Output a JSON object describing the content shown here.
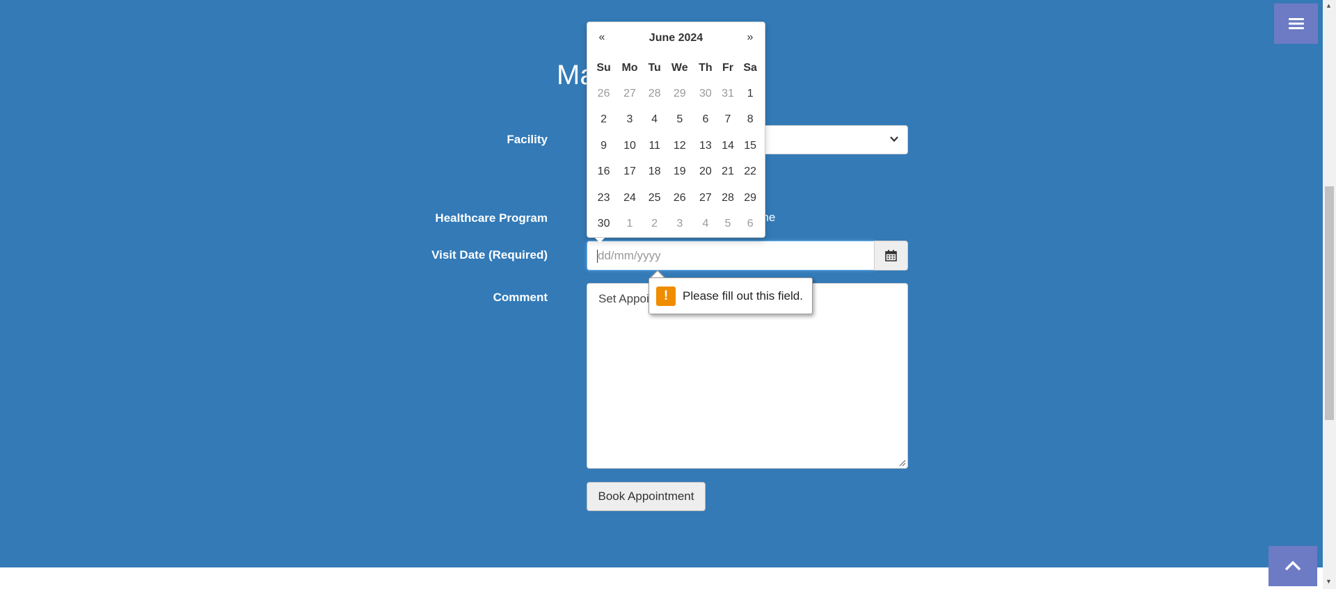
{
  "page": {
    "title_visible": "Ma"
  },
  "form": {
    "facility_label": "Facility",
    "program_label": "Healthcare Program",
    "program_value_visible": "one",
    "visit_date_label": "Visit Date (Required)",
    "visit_date_placeholder": "dd/mm/yyyy",
    "visit_date_value": "",
    "comment_label": "Comment",
    "comment_value_visible": "Set Appoi",
    "book_button": "Book Appointment"
  },
  "datepicker": {
    "prev": "«",
    "next": "»",
    "title": "June 2024",
    "weekdays": [
      "Su",
      "Mo",
      "Tu",
      "We",
      "Th",
      "Fr",
      "Sa"
    ],
    "weeks": [
      [
        {
          "d": "26",
          "m": true
        },
        {
          "d": "27",
          "m": true
        },
        {
          "d": "28",
          "m": true
        },
        {
          "d": "29",
          "m": true
        },
        {
          "d": "30",
          "m": true
        },
        {
          "d": "31",
          "m": true
        },
        {
          "d": "1",
          "m": false
        }
      ],
      [
        {
          "d": "2",
          "m": false
        },
        {
          "d": "3",
          "m": false
        },
        {
          "d": "4",
          "m": false
        },
        {
          "d": "5",
          "m": false
        },
        {
          "d": "6",
          "m": false
        },
        {
          "d": "7",
          "m": false
        },
        {
          "d": "8",
          "m": false
        }
      ],
      [
        {
          "d": "9",
          "m": false
        },
        {
          "d": "10",
          "m": false
        },
        {
          "d": "11",
          "m": false
        },
        {
          "d": "12",
          "m": false
        },
        {
          "d": "13",
          "m": false
        },
        {
          "d": "14",
          "m": false
        },
        {
          "d": "15",
          "m": false
        }
      ],
      [
        {
          "d": "16",
          "m": false
        },
        {
          "d": "17",
          "m": false
        },
        {
          "d": "18",
          "m": false
        },
        {
          "d": "19",
          "m": false
        },
        {
          "d": "20",
          "m": false
        },
        {
          "d": "21",
          "m": false
        },
        {
          "d": "22",
          "m": false
        }
      ],
      [
        {
          "d": "23",
          "m": false
        },
        {
          "d": "24",
          "m": false
        },
        {
          "d": "25",
          "m": false
        },
        {
          "d": "26",
          "m": false
        },
        {
          "d": "27",
          "m": false
        },
        {
          "d": "28",
          "m": false
        },
        {
          "d": "29",
          "m": false
        }
      ],
      [
        {
          "d": "30",
          "m": false
        },
        {
          "d": "1",
          "m": true
        },
        {
          "d": "2",
          "m": true
        },
        {
          "d": "3",
          "m": true
        },
        {
          "d": "4",
          "m": true
        },
        {
          "d": "5",
          "m": true
        },
        {
          "d": "6",
          "m": true
        }
      ]
    ]
  },
  "validation": {
    "message": "Please fill out this field."
  },
  "icons": {
    "menu": "hamburger-menu-icon",
    "calendar": "calendar-icon",
    "scroll_top": "chevron-up-icon",
    "warning": "warning-icon",
    "select": "chevron-down-icon"
  },
  "colors": {
    "page_bg": "#337ab7",
    "menu_button": "#6c7bc4",
    "warning": "#f08c00"
  }
}
